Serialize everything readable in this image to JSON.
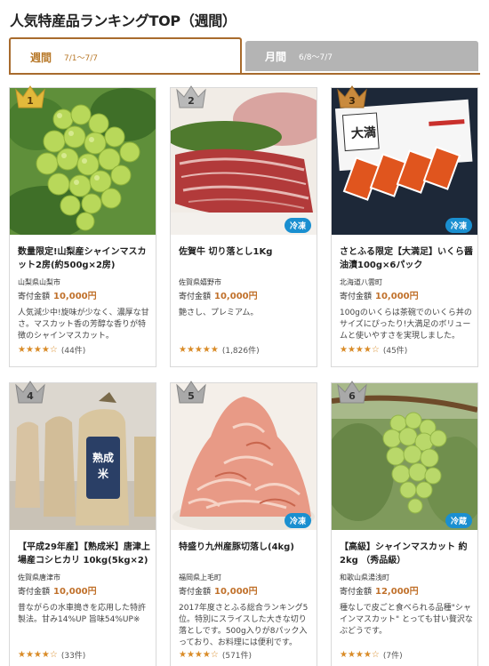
{
  "title": "人気特産品ランキングTOP（週間）",
  "tabs": [
    {
      "label": "週間",
      "range": "7/1～7/7"
    },
    {
      "label": "月間",
      "range": "6/8～7/7"
    }
  ],
  "price_label": "寄付金額",
  "items": [
    {
      "rank": "1",
      "name": "数量限定!山梨産シャインマスカット2房(約500g×2房)",
      "region": "山梨県山梨市",
      "price": "10,000円",
      "desc": "人気減少中!旋味が少なく、濃厚な甘さ。マスカット香の芳醇な香りが特徴のシャインマスカット。",
      "stars": "★★★★☆",
      "rating_count": 4.5,
      "reviews": "(44件)",
      "badge": ""
    },
    {
      "rank": "2",
      "name": "佐賀牛 切り落とし1Kg",
      "region": "佐賀県嬉野市",
      "price": "10,000円",
      "desc": "艶さし、プレミアム。",
      "stars": "★★★★★",
      "rating_count": 4.8,
      "reviews": "(1,826件)",
      "badge": "冷凍"
    },
    {
      "rank": "3",
      "name": "さとふる限定【大満足】いくら醤油漬100g×6パック",
      "region": "北海道八雲町",
      "price": "10,000円",
      "desc": "100gのいくらは茶碗でのいくら丼のサイズにぴったり!大満足のボリュームと使いやすさを実現しました。",
      "stars": "★★★★☆",
      "rating_count": 4.4,
      "reviews": "(45件)",
      "badge": "冷凍"
    },
    {
      "rank": "4",
      "name": "【平成29年産】【熟成米】唐津上場産コシヒカリ 10kg(5kg×2)",
      "region": "佐賀県唐津市",
      "price": "10,000円",
      "desc": "昔ながらの水車搗きを応用した特許製法。甘み14%UP 旨味54%UP※",
      "stars": "★★★★☆",
      "rating_count": 4.4,
      "reviews": "(33件)",
      "badge": ""
    },
    {
      "rank": "5",
      "name": "特盛り九州産豚切落し(4kg)",
      "region": "福岡県上毛町",
      "price": "10,000円",
      "desc": "2017年度さとふる総合ランキング5位。特別にスライスした大きな切り落としです。500g入りが8パック入っており、お料理には便利です。",
      "stars": "★★★★☆",
      "rating_count": 4.1,
      "reviews": "(571件)",
      "badge": "冷凍"
    },
    {
      "rank": "6",
      "name": "【高級】シャインマスカット 約2kg （秀品級）",
      "region": "和歌山県湯浅町",
      "price": "12,000円",
      "desc": "種なしで皮ごと食べられる品種\"シャインマスカット\" とっても甘い贅沢なぶどうです。",
      "stars": "★★★★☆",
      "rating_count": 4.5,
      "reviews": "(7件)",
      "badge": "冷蔵"
    }
  ],
  "colors": {
    "accent": "#b8792a",
    "gold": "#e2b93b",
    "silver": "#b9b9b9",
    "bronze": "#c98a3d",
    "badge": "#1a8fd0"
  }
}
